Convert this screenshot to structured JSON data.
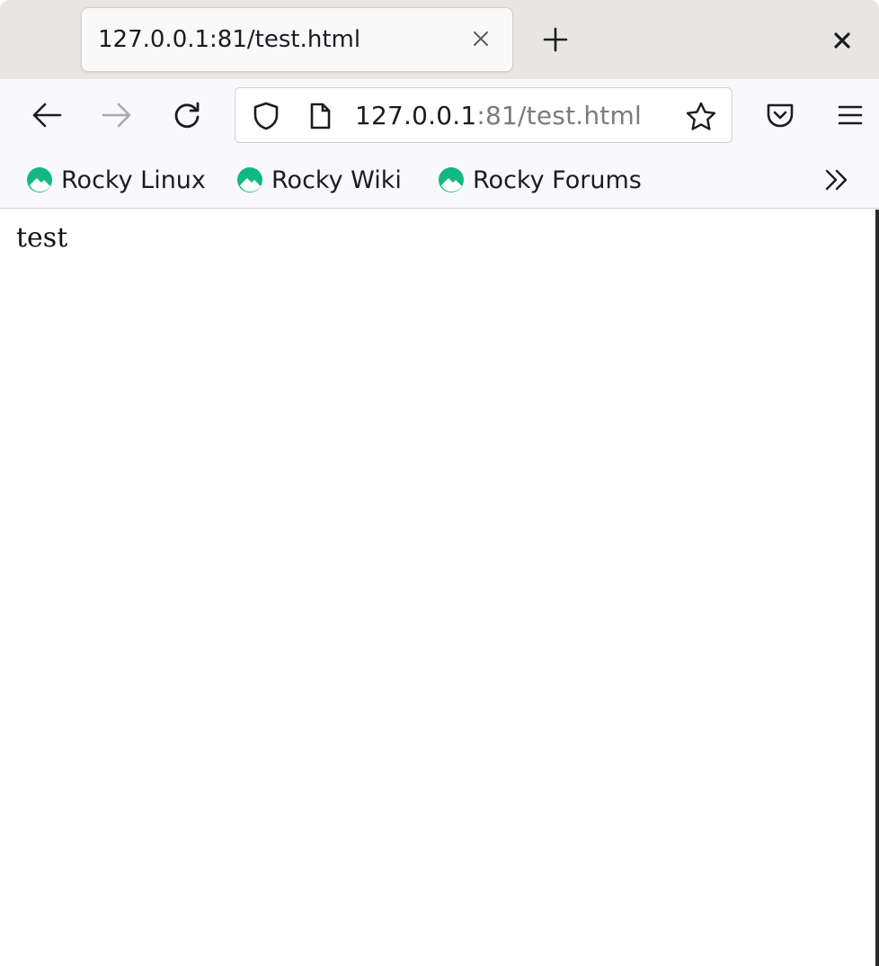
{
  "tab": {
    "title": "127.0.0.1:81/test.html"
  },
  "urlbar": {
    "host": "127.0.0.1",
    "rest": ":81/test.html"
  },
  "bookmarks": [
    {
      "label": "Rocky Linux",
      "icon": "rocky-logo-icon"
    },
    {
      "label": "Rocky Wiki",
      "icon": "rocky-logo-icon"
    },
    {
      "label": "Rocky Forums",
      "icon": "rocky-logo-icon"
    }
  ],
  "content": {
    "text": "test"
  },
  "colors": {
    "rocky_green": "#10b981",
    "tabstrip_bg": "#e8e6e3",
    "toolbar_bg": "#f9f9fb"
  }
}
